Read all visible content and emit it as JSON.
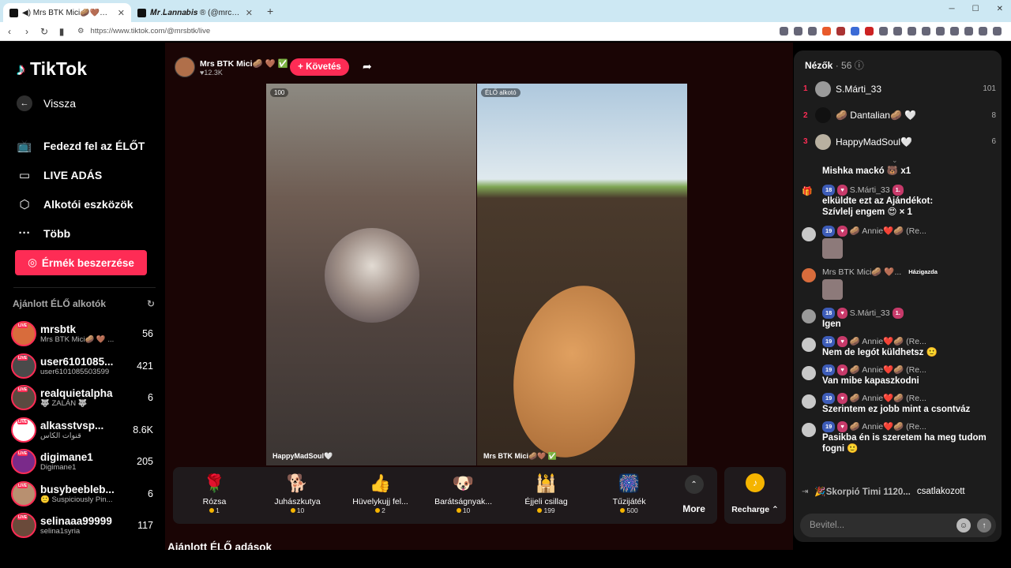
{
  "browser": {
    "tabs": [
      {
        "title": "◀) Mrs BTK Mici🥔🤎🤍✅ (@m",
        "active": true
      },
      {
        "title": "𝑴𝒓.𝑳𝒂𝒏𝒏𝒂𝒃𝒊𝒔 ® (@mrcannabis",
        "active": false
      }
    ],
    "url": "https://www.tiktok.com/@mrsbtk/live",
    "new_tab": "+",
    "window_controls": [
      "─",
      "☐",
      "✕"
    ]
  },
  "sidebar": {
    "logo": "TikTok",
    "back_label": "Vissza",
    "menu": [
      {
        "label": "Fedezd fel az ÉLŐT",
        "icon": "live-tv-icon"
      },
      {
        "label": "LIVE ADÁS",
        "icon": "video-camera-icon"
      },
      {
        "label": "Alkotói eszközök",
        "icon": "creator-tools-icon"
      },
      {
        "label": "Több",
        "icon": "more-dots-icon"
      }
    ],
    "coins_button": "Érmék beszerzése",
    "recommended_title": "Ajánlott ÉLŐ alkotók",
    "creators": [
      {
        "name": "mrsbtk",
        "sub": "Mrs BTK Mici🥔 🤎 ...",
        "count": "56",
        "color": "#d86c3c"
      },
      {
        "name": "user6101085...",
        "sub": "user6101085503599",
        "count": "421",
        "color": "#4a4a4a"
      },
      {
        "name": "realquietalpha",
        "sub": "🐺 ZALÁN 🐺",
        "count": "6",
        "color": "#5a4a40"
      },
      {
        "name": "alkasstvsp...",
        "sub": "قنوات الكأس",
        "count": "8.6K",
        "color": "#ffffff"
      },
      {
        "name": "digimane1",
        "sub": "Digimane1",
        "count": "205",
        "color": "#7a2a8a"
      },
      {
        "name": "busybeebleb...",
        "sub": "🙂 Suspiciously Pin...",
        "count": "6",
        "color": "#b89070"
      },
      {
        "name": "selinaaa99999",
        "sub": "selina1syria",
        "count": "117",
        "color": "#6a4a3a"
      }
    ]
  },
  "stream": {
    "host_name": "Mrs BTK Mici🥔 🤎 ✅",
    "host_likes": "♥12.3K",
    "follow_label": "+ Követés",
    "left_badge": "100",
    "left_name": "HappyMadSoul🤍",
    "right_badge": "ÉLŐ alkotó",
    "right_name": "Mrs BTK Mici🥔🤎 ✅",
    "gifts": [
      {
        "name": "Rózsa",
        "price": "1",
        "icon": "🌹"
      },
      {
        "name": "Juhászkutya",
        "price": "10",
        "icon": "🐕"
      },
      {
        "name": "Hüvelykujj fel...",
        "price": "2",
        "icon": "👍"
      },
      {
        "name": "Barátságnyak...",
        "price": "10",
        "icon": "🐶"
      },
      {
        "name": "Éjjeli csillag",
        "price": "199",
        "icon": "🕌"
      },
      {
        "name": "Tűzijáték",
        "price": "500",
        "icon": "🎆"
      }
    ],
    "more_label": "More",
    "recharge_label": "Recharge ⌃",
    "recommended_live_title": "Ajánlott ÉLŐ adások"
  },
  "viewers": {
    "title": "Nézők",
    "count": "· 56",
    "list": [
      {
        "rank": "1",
        "name": "S.Márti_33",
        "score": "101"
      },
      {
        "rank": "2",
        "name": "🥔 Dantalian🥔 🤍",
        "score": "8"
      },
      {
        "rank": "3",
        "name": "HappyMadSoul🤍",
        "score": "6"
      }
    ]
  },
  "chat": {
    "messages": [
      {
        "type": "gift-cont",
        "text": "Mishka mackó 🐻 x1"
      },
      {
        "type": "gift",
        "level": "18",
        "user": "S.Márti_33",
        "fan": "1.",
        "line1": "elküldte ezt az Ajándékot:",
        "line2": "Szívlelj engem 😍 × 1"
      },
      {
        "type": "msg",
        "level": "19",
        "user": "🥔 Annie❤️🥔 (Re...",
        "text": ""
      },
      {
        "type": "host",
        "user": "Mrs BTK Mici🥔 🤎...",
        "badge": "Házigazda",
        "text": ""
      },
      {
        "type": "msg",
        "level": "18",
        "user": "S.Márti_33",
        "fan": "1.",
        "text": "Igen"
      },
      {
        "type": "msg",
        "level": "19",
        "user": "🥔 Annie❤️🥔 (Re...",
        "text": "Nem de legót küldhetsz 🙂"
      },
      {
        "type": "msg",
        "level": "19",
        "user": "🥔 Annie❤️🥔 (Re...",
        "text": "Van mibe kapaszkodni"
      },
      {
        "type": "msg",
        "level": "19",
        "user": "🥔 Annie❤️🥔 (Re...",
        "text": "Szerintem ez jobb mint a csontváz"
      },
      {
        "type": "msg",
        "level": "19",
        "user": "🥔 Annie❤️🥔 (Re...",
        "text": "Pasikba én is szeretem ha meg tudom fogni 🙂"
      }
    ],
    "joined_user": "🎉Skorpió Timi 1120...",
    "joined_text": "csatlakozott",
    "input_placeholder": "Bevitel..."
  }
}
